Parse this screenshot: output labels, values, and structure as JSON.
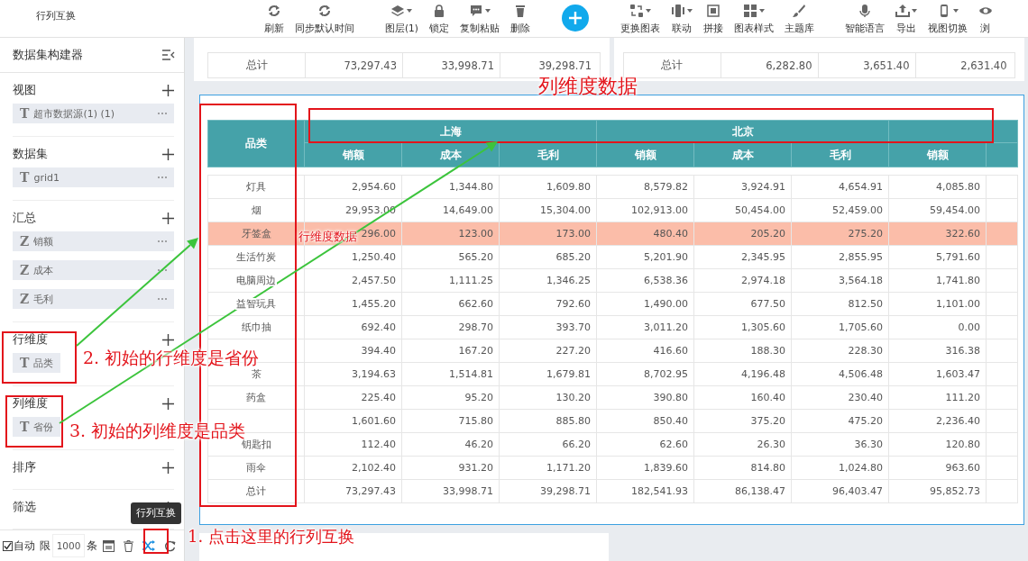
{
  "toolbar": {
    "title": "行列互换",
    "groups": [
      [
        {
          "kind": "button",
          "label": "刷新",
          "dropdown": false
        },
        {
          "kind": "button",
          "label": "同步默认时间",
          "dropdown": false
        }
      ],
      [
        {
          "kind": "button",
          "label": "图层(1)",
          "dropdown": true
        },
        {
          "kind": "button",
          "label": "锁定",
          "dropdown": false
        },
        {
          "kind": "button",
          "label": "复制粘贴",
          "dropdown": true
        },
        {
          "kind": "button",
          "label": "删除",
          "dropdown": false
        }
      ],
      [
        {
          "kind": "add"
        }
      ],
      [
        {
          "kind": "button",
          "label": "更换图表",
          "dropdown": true
        },
        {
          "kind": "button",
          "label": "联动",
          "dropdown": true
        },
        {
          "kind": "button",
          "label": "拼接",
          "dropdown": false
        },
        {
          "kind": "button",
          "label": "图表样式",
          "dropdown": true
        },
        {
          "kind": "button",
          "label": "主题库",
          "dropdown": false
        }
      ],
      [
        {
          "kind": "button",
          "label": "智能语言",
          "dropdown": false
        },
        {
          "kind": "button",
          "label": "导出",
          "dropdown": true
        },
        {
          "kind": "button",
          "label": "视图切换",
          "dropdown": true
        },
        {
          "kind": "button",
          "label": "浏",
          "dropdown": false
        }
      ]
    ]
  },
  "sidebar": {
    "title": "数据集构建器",
    "sections": [
      {
        "title": "视图",
        "fields": [
          {
            "type": "T",
            "name": "超市数据源(1) (1)",
            "menu": true
          }
        ]
      },
      {
        "title": "数据集",
        "fields": [
          {
            "type": "T",
            "name": "grid1",
            "menu": true
          }
        ]
      },
      {
        "title": "汇总",
        "fields": [
          {
            "type": "Z",
            "name": "销额",
            "menu": true
          },
          {
            "type": "Z",
            "name": "成本",
            "menu": true
          },
          {
            "type": "Z",
            "name": "毛利",
            "menu": true
          }
        ]
      },
      {
        "title": "行维度",
        "fields": [
          {
            "type": "T",
            "name": "品类",
            "menu": false
          }
        ]
      },
      {
        "title": "列维度",
        "fields": [
          {
            "type": "T",
            "name": "省份",
            "menu": false
          }
        ]
      },
      {
        "title": "排序"
      },
      {
        "title": "筛选"
      }
    ]
  },
  "bottom_bar": {
    "auto": {
      "label": "自动",
      "checked": true
    },
    "limit_label": "限",
    "limit_value": "1000",
    "unit": "条",
    "tooltip": "行列互换"
  },
  "summary_cards": [
    {
      "label": "总计",
      "values": [
        "73,297.43",
        "33,998.71",
        "39,298.71"
      ]
    },
    {
      "label": "总计",
      "values": [
        "6,282.80",
        "3,651.40",
        "2,631.40"
      ]
    }
  ],
  "pivot_table": {
    "row_header": "品类",
    "groups": [
      {
        "label": "上海"
      },
      {
        "label": "北京"
      }
    ],
    "measures": [
      "销额",
      "成本",
      "毛利",
      "销额",
      "成本",
      "毛利",
      "销额"
    ],
    "rows": [
      {
        "category": "灯具",
        "selected": false,
        "values": [
          "2,954.60",
          "1,344.80",
          "1,609.80",
          "8,579.82",
          "3,924.91",
          "4,654.91",
          "4,085.80"
        ]
      },
      {
        "category": "烟",
        "selected": false,
        "values": [
          "29,953.00",
          "14,649.00",
          "15,304.00",
          "102,913.00",
          "50,454.00",
          "52,459.00",
          "59,454.00"
        ]
      },
      {
        "category": "牙签盒",
        "selected": true,
        "values": [
          "296.00",
          "123.00",
          "173.00",
          "480.40",
          "205.20",
          "275.20",
          "322.60"
        ]
      },
      {
        "category": "生活竹炭",
        "selected": false,
        "values": [
          "1,250.40",
          "565.20",
          "685.20",
          "5,201.90",
          "2,345.95",
          "2,855.95",
          "5,791.60"
        ]
      },
      {
        "category": "电脑周边",
        "selected": false,
        "values": [
          "2,457.50",
          "1,111.25",
          "1,346.25",
          "6,538.36",
          "2,974.18",
          "3,564.18",
          "1,741.80"
        ]
      },
      {
        "category": "益智玩具",
        "selected": false,
        "values": [
          "1,455.20",
          "662.60",
          "792.60",
          "1,490.00",
          "677.50",
          "812.50",
          "1,101.00"
        ]
      },
      {
        "category": "纸巾抽",
        "selected": false,
        "values": [
          "692.40",
          "298.70",
          "393.70",
          "3,011.20",
          "1,305.60",
          "1,705.60",
          "0.00"
        ]
      },
      {
        "selected": false,
        "values": [
          "394.40",
          "167.20",
          "227.20",
          "416.60",
          "188.30",
          "228.30",
          "316.38"
        ]
      },
      {
        "category": "茶",
        "selected": false,
        "values": [
          "3,194.63",
          "1,514.81",
          "1,679.81",
          "8,702.95",
          "4,196.48",
          "4,506.48",
          "1,603.47"
        ]
      },
      {
        "category": "药盒",
        "selected": false,
        "values": [
          "225.40",
          "95.20",
          "130.20",
          "390.80",
          "160.40",
          "230.40",
          "111.20"
        ]
      },
      {
        "selected": false,
        "values": [
          "1,601.60",
          "715.80",
          "885.80",
          "850.40",
          "375.20",
          "475.20",
          "2,236.40"
        ]
      },
      {
        "category": "钥匙扣",
        "selected": false,
        "values": [
          "112.40",
          "46.20",
          "66.20",
          "62.60",
          "26.30",
          "36.30",
          "120.80"
        ]
      },
      {
        "category": "雨伞",
        "selected": false,
        "values": [
          "2,102.40",
          "931.20",
          "1,171.20",
          "1,839.60",
          "814.80",
          "1,024.80",
          "963.60"
        ]
      },
      {
        "category": "总计",
        "selected": false,
        "values": [
          "73,297.43",
          "33,998.71",
          "39,298.71",
          "182,541.93",
          "86,138.47",
          "96,403.47",
          "95,852.73"
        ]
      }
    ]
  },
  "annotations": [
    {
      "text": "列维度数据"
    },
    {
      "text": "行维度数据"
    },
    {
      "text": "2. 初始的行维度是省份"
    },
    {
      "text": "3. 初始的列维度是品类"
    },
    {
      "text": "1. 点击这里的行列互换"
    }
  ]
}
